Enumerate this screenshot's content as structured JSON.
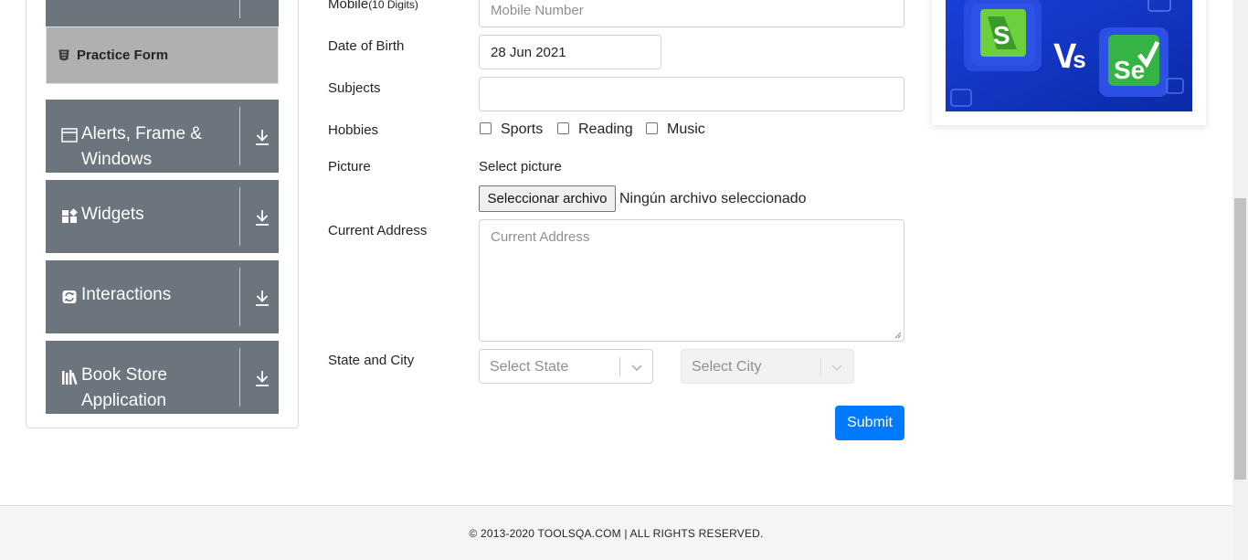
{
  "sidebar": {
    "practice_form_label": "Practice Form",
    "groups": [
      {
        "label_line1": "Alerts, Frame &",
        "label_line2": "Windows"
      },
      {
        "label_line1": "Widgets"
      },
      {
        "label_line1": "Interactions"
      },
      {
        "label_line1": "Book Store",
        "label_line2": "Application"
      }
    ]
  },
  "form": {
    "mobile_label": "Mobile",
    "mobile_hint": "(10 Digits)",
    "mobile_placeholder": "Mobile Number",
    "dob_label": "Date of Birth",
    "dob_value": "28 Jun 2021",
    "subjects_label": "Subjects",
    "subjects_value": "",
    "hobbies_label": "Hobbies",
    "hobbies": [
      "Sports",
      "Reading",
      "Music"
    ],
    "picture_label": "Picture",
    "select_picture_label": "Select picture",
    "file_button_label": "Seleccionar archivo",
    "file_status": "Ningún archivo seleccionado",
    "address_label": "Current Address",
    "address_placeholder": "Current Address",
    "state_city_label": "State and City",
    "state_placeholder": "Select State",
    "city_placeholder": "Select City",
    "submit_label": "Submit"
  },
  "footer": {
    "copyright": "© 2013-2020 TOOLSQA.COM | ALL RIGHTS RESERVED."
  },
  "colors": {
    "sidebar_group": "#6c757d",
    "practice_active": "#b0b0b0",
    "submit": "#007bff",
    "ad_background": "#1037c9"
  },
  "icons": {
    "practice": "html5-icon",
    "alerts": "window-icon",
    "widgets": "widgets-grid-icon",
    "interactions": "refresh-icon",
    "book_store": "books-icon",
    "group_toggle": "download-arrow-icon",
    "select": "chevron-down-icon"
  }
}
